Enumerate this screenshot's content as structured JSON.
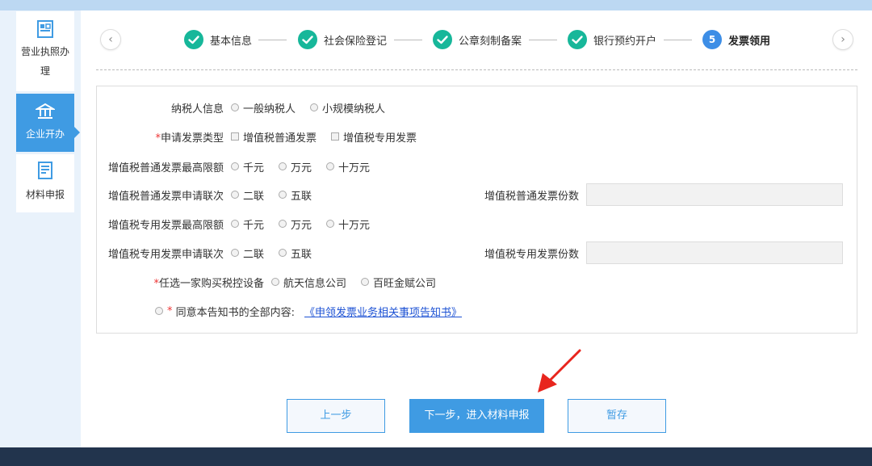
{
  "sidebar": {
    "items": [
      {
        "label": "营业执照办理",
        "icon": "license-icon",
        "active": false
      },
      {
        "label": "企业开办",
        "icon": "bank-icon",
        "active": true
      },
      {
        "label": "材料申报",
        "icon": "document-icon",
        "active": false
      }
    ]
  },
  "steps": [
    {
      "label": "基本信息",
      "status": "done"
    },
    {
      "label": "社会保险登记",
      "status": "done"
    },
    {
      "label": "公章刻制备案",
      "status": "done"
    },
    {
      "label": "银行预约开户",
      "status": "done"
    },
    {
      "label": "发票领用",
      "status": "current",
      "number": "5"
    }
  ],
  "nav": {
    "prev": "‹",
    "next": "›"
  },
  "form": {
    "taxpayer_info": {
      "label": "纳税人信息",
      "options": [
        "一般纳税人",
        "小规模纳税人"
      ]
    },
    "invoice_type": {
      "required": "*",
      "label": "申请发票类型",
      "options": [
        "增值税普通发票",
        "增值税专用发票"
      ]
    },
    "ordinary_max_limit": {
      "label": "增值税普通发票最高限额",
      "options": [
        "千元",
        "万元",
        "十万元"
      ]
    },
    "ordinary_copies": {
      "label": "增值税普通发票申请联次",
      "options": [
        "二联",
        "五联"
      ],
      "count_label": "增值税普通发票份数",
      "count_value": ""
    },
    "special_max_limit": {
      "label": "增值税专用发票最高限额",
      "options": [
        "千元",
        "万元",
        "十万元"
      ]
    },
    "special_copies": {
      "label": "增值税专用发票申请联次",
      "options": [
        "二联",
        "五联"
      ],
      "count_label": "增值税专用发票份数",
      "count_value": ""
    },
    "tax_device": {
      "required": "*",
      "label": "任选一家购买税控设备",
      "options": [
        "航天信息公司",
        "百旺金赋公司"
      ]
    },
    "agreement": {
      "required": "*",
      "label": " 同意本告知书的全部内容:",
      "link": "《申领发票业务相关事项告知书》"
    }
  },
  "buttons": {
    "prev": "上一步",
    "next": "下一步，进入材料申报",
    "save": "暂存"
  },
  "colors": {
    "primary": "#3f9be3",
    "done": "#17b79a",
    "current": "#3d8ee6",
    "required": "#e33333",
    "link": "#1d52d4",
    "footer": "#22344d",
    "annotation_arrow": "#e8251d"
  }
}
